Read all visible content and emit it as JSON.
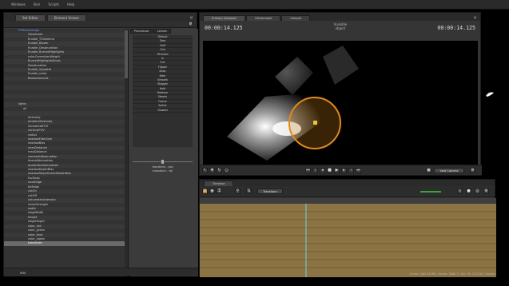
{
  "menubar": {
    "items": [
      "Windows",
      "Skin",
      "Scripts",
      "Help"
    ]
  },
  "left_panel": {
    "tabs": [
      {
        "label": "Set Editor"
      },
      {
        "label": "Element Viewer"
      }
    ],
    "tree_rows": [
      {
        "label": "FFMovieImage"
      },
      {
        "label": "ViewScale"
      },
      {
        "label": "Enable_TVGamma"
      },
      {
        "label": "Enable_Bloom"
      },
      {
        "label": "Enable_Desaturation"
      },
      {
        "label": "Enable_BurnedHighlights"
      },
      {
        "label": "colorCorrectionWeight"
      },
      {
        "label": "BurnedHighlightsScale"
      },
      {
        "label": "Desaturation"
      },
      {
        "label": "Enable_Vignette"
      },
      {
        "label": "Enable_noise"
      },
      {
        "label": "BloomAmount"
      },
      {
        "label": ""
      },
      {
        "label": ""
      },
      {
        "label": ""
      },
      {
        "label": ""
      },
      {
        "label": ""
      },
      {
        "label": "lights"
      },
      {
        "label": "all"
      },
      {
        "label": ""
      },
      {
        "label": "intensity"
      },
      {
        "label": "ambientIntensity"
      },
      {
        "label": "horizontalFOV"
      },
      {
        "label": "verticalFOV"
      },
      {
        "label": "radius"
      },
      {
        "label": "shadowFilterSize"
      },
      {
        "label": "shadowBias"
      },
      {
        "label": "nearDistance"
      },
      {
        "label": "maxDistance"
      },
      {
        "label": "constantAttenuation"
      },
      {
        "label": "linearAttenuation"
      },
      {
        "label": "quadraticAttenuation"
      },
      {
        "label": "shadowDepthBias"
      },
      {
        "label": "shadowSlopeScaledDepthBias"
      },
      {
        "label": "fovDegs"
      },
      {
        "label": "nearEdge"
      },
      {
        "label": "farEdge"
      },
      {
        "label": "cutOn"
      },
      {
        "label": "cutOff"
      },
      {
        "label": "volumetricIntensity"
      },
      {
        "label": "noiseStrength"
      },
      {
        "label": "width"
      },
      {
        "label": "edgeWidth"
      },
      {
        "label": "height"
      },
      {
        "label": "edgeHeight"
      },
      {
        "label": "color_red"
      },
      {
        "label": "color_green"
      },
      {
        "label": "color_blue"
      },
      {
        "label": "color_alpha"
      },
      {
        "label": "transform"
      }
    ],
    "preset_tabs": [
      {
        "label": "Procedural"
      },
      {
        "label": "Lenses"
      }
    ],
    "presets": [
      "Default",
      "Zero",
      "Half",
      "One",
      "Pinchoid",
      "In",
      "Out",
      "Flipper",
      "Drop",
      "Jitter",
      "Smooth",
      "Stagger",
      "Hold",
      "Release",
      "Steady",
      "Frame",
      "Spline",
      "Stowed"
    ],
    "transform_list": [
      "transform - pos",
      "transform - rot"
    ],
    "bottom_label": "env"
  },
  "viewer": {
    "tabs": [
      {
        "label": "Primary Viewport",
        "active": true
      },
      {
        "label": "Orthomodel"
      },
      {
        "label": "Cample"
      }
    ],
    "timecode_left": "00:00:14.125",
    "timecode_right": "00:00:14.125",
    "center_label_line1": "Invisible",
    "center_label_line2": "object",
    "controls": {
      "view_camera_label": "Void Camera"
    }
  },
  "timeline": {
    "tab_label": "Timeline",
    "dropdown_value": "Transform"
  },
  "statusbar": {
    "text": "1 Item: 1461.46 MB | Games: 3800.7 | Sec: 3%  1274.00 | Sample"
  },
  "colors": {
    "accent_orange": "#e08a1c",
    "track_fill": "#8b7343",
    "tree_blue": "#7aa0e6"
  }
}
